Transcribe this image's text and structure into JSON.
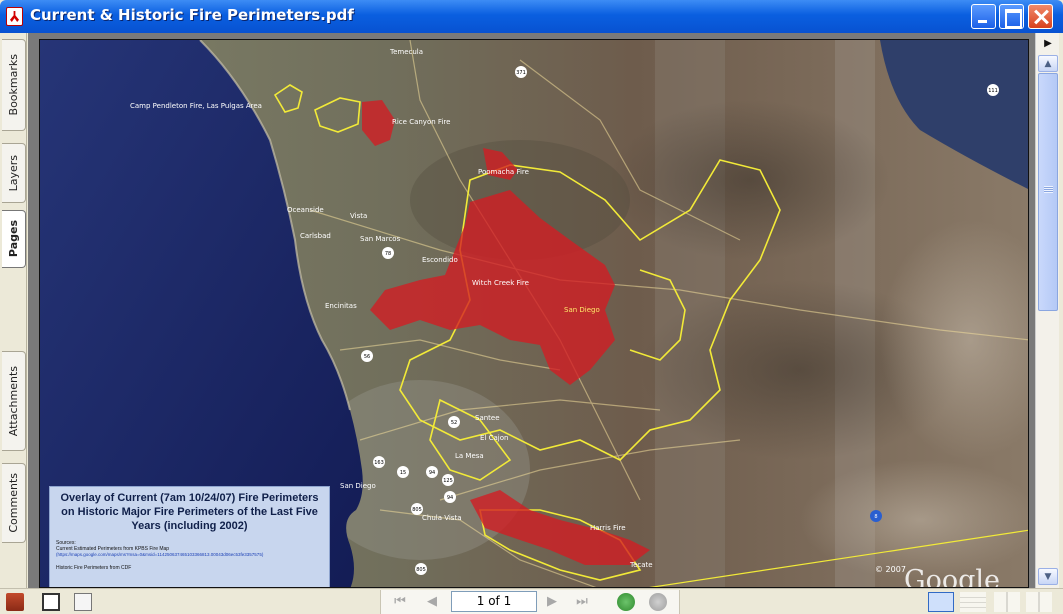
{
  "window": {
    "title": "Current & Historic Fire Perimeters.pdf"
  },
  "nav_tabs": [
    {
      "label": "Bookmarks"
    },
    {
      "label": "Layers"
    },
    {
      "label": "Pages"
    },
    {
      "label": "Attachments"
    },
    {
      "label": "Comments"
    }
  ],
  "map": {
    "places": [
      "Temecula",
      "Camp Pendleton Fire, Las Pulgas Area",
      "Rice Canyon Fire",
      "Poomacha Fire",
      "Oceanside",
      "Vista",
      "Carlsbad",
      "San Marcos",
      "Escondido",
      "Witch Creek Fire",
      "San Diego",
      "Encinitas",
      "Santee",
      "El Cajon",
      "La Mesa",
      "San Diego",
      "Chula Vista",
      "Harris Fire",
      "Tecate"
    ],
    "shields": [
      "371",
      "111",
      "78",
      "56",
      "52",
      "163",
      "15",
      "94",
      "125",
      "94",
      "805",
      "805",
      "8"
    ],
    "copyright": "© 2007",
    "watermark": "Google"
  },
  "legend": {
    "title": "Overlay of Current (7am 10/24/07) Fire Perimeters on Historic Major Fire Perimeters of the Last Five Years (including 2002)",
    "sources": "Sources:",
    "current_src": "Current Estimated Perimeters from KPBS Fire Map",
    "current_url": "(https://maps.google.com/maps/ms?msa=0&msid=114250637465103366813.00043d06ec53fe3357575)",
    "historic_src": "Historic Fire Perimeters from CDF"
  },
  "statusbar": {
    "page_display": "1 of 1"
  },
  "colors": {
    "fire": "#d41c22",
    "perimeter": "#f5ec35",
    "ocean": "#1d2a6e",
    "title_bar": "#0a5fe0"
  }
}
